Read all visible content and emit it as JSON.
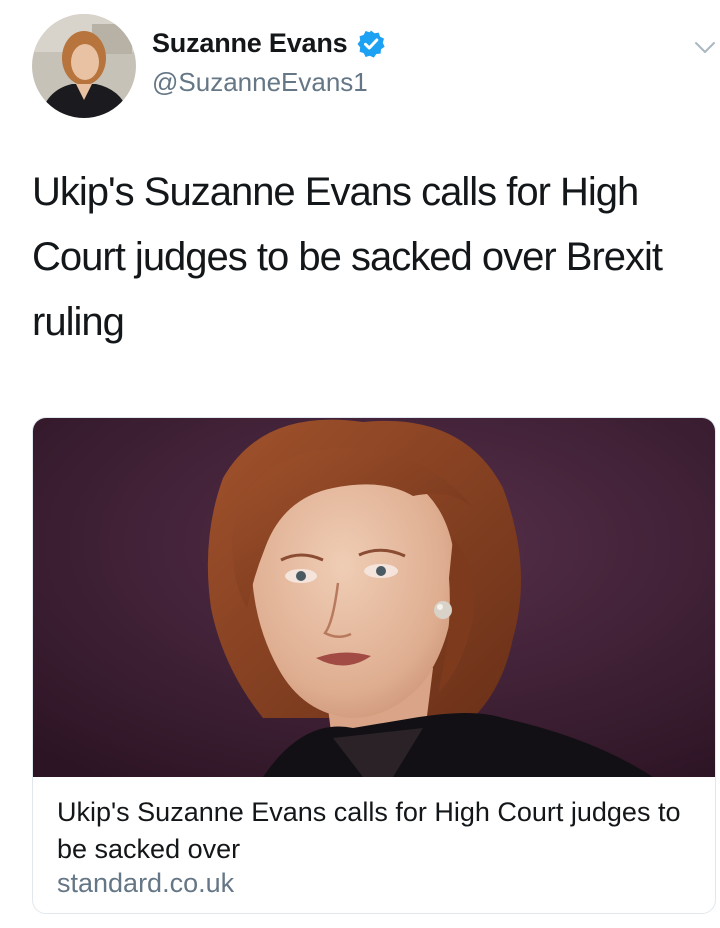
{
  "tweet": {
    "author": {
      "name": "Suzanne Evans",
      "handle": "@SuzanneEvans1",
      "verified_icon": "verified-badge-icon",
      "avatar_icon": "profile-photo"
    },
    "menu_icon": "chevron-down-icon",
    "text": "Ukip's Suzanne Evans calls for High Court judges to be sacked over Brexit ruling",
    "card": {
      "image": "article-photo",
      "title": "Ukip's Suzanne Evans calls for High Court judges to be sacked over",
      "domain": "standard.co.uk"
    }
  },
  "colors": {
    "text_primary": "#14171a",
    "text_secondary": "#657786",
    "verified_blue": "#1da1f2",
    "card_border": "#e1e8ed",
    "photo_background": "#3f1f35"
  }
}
